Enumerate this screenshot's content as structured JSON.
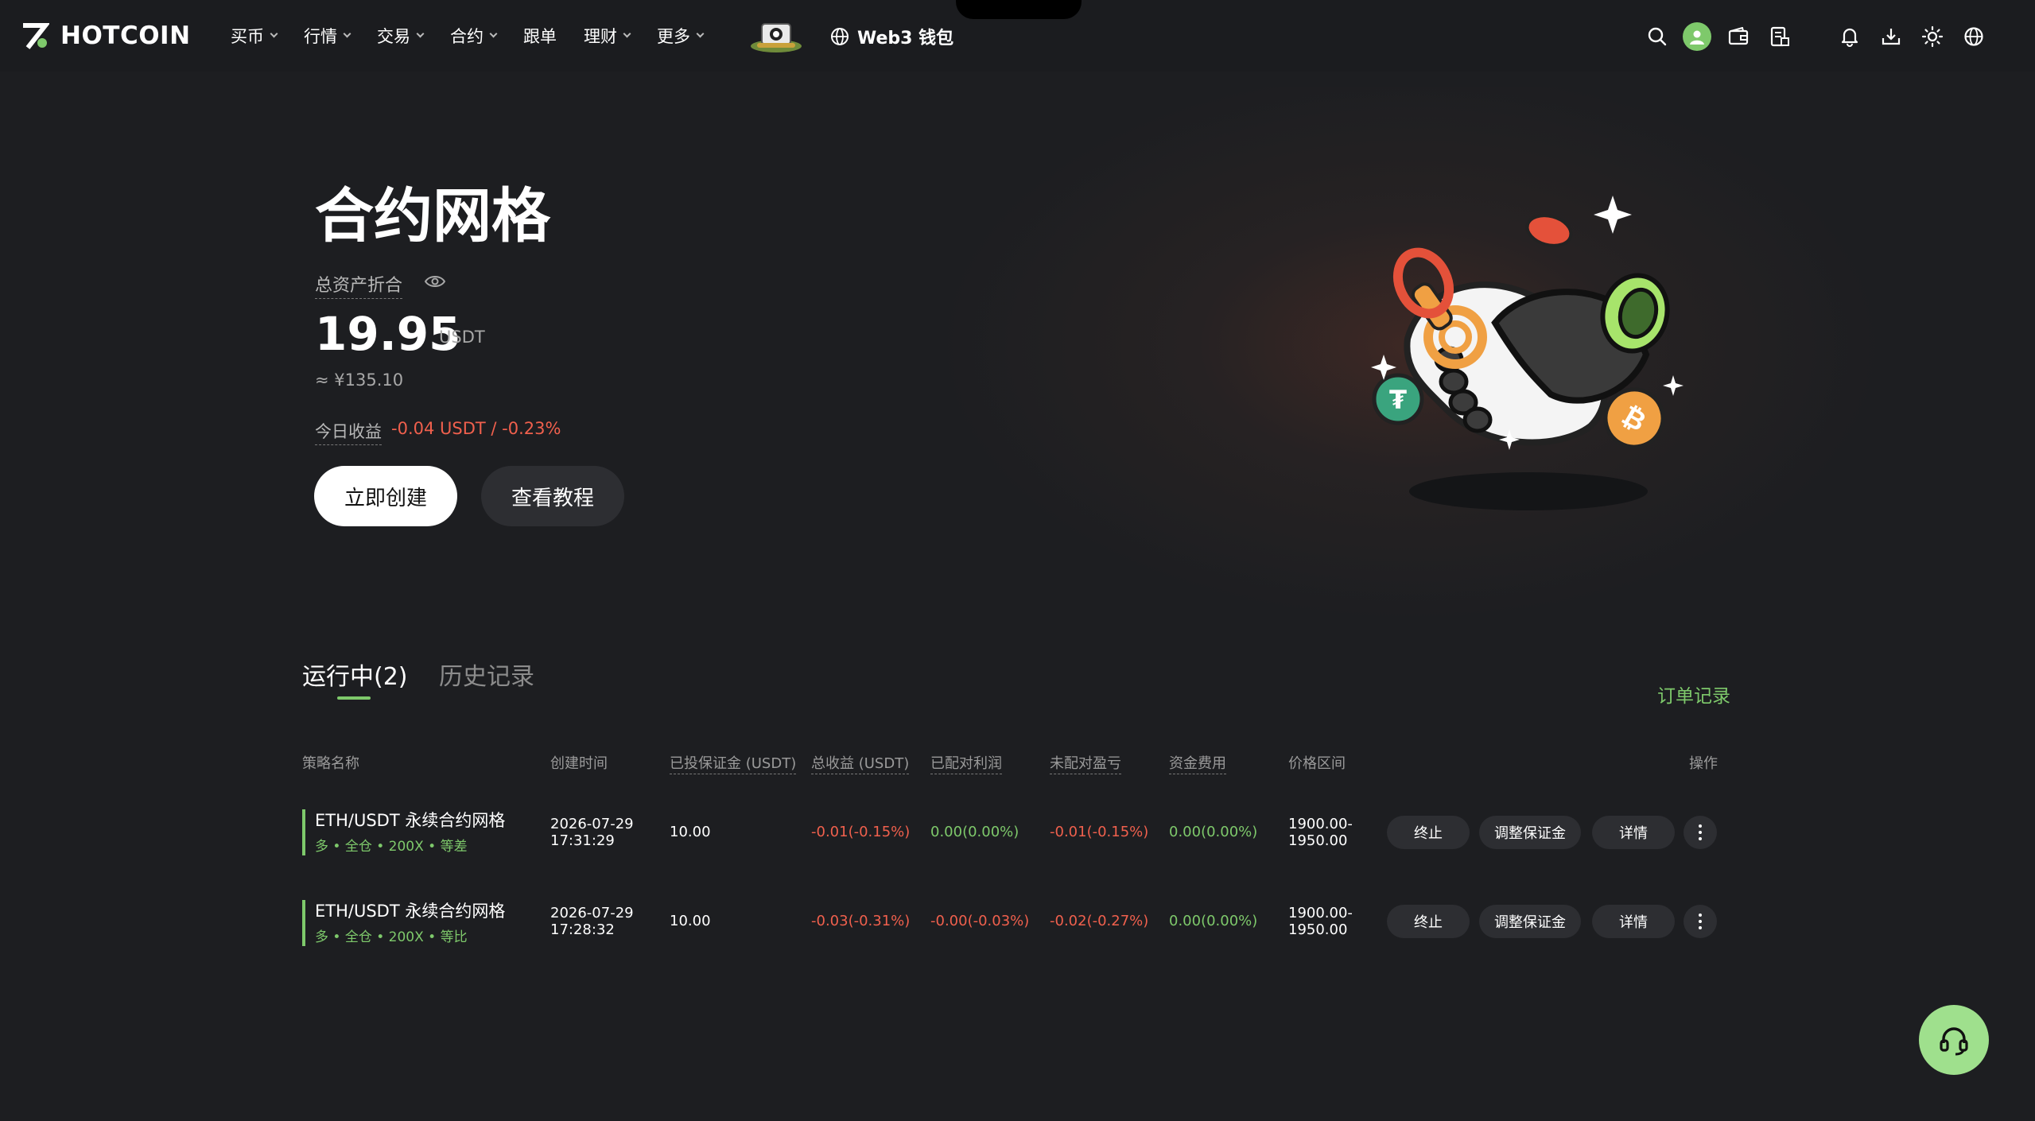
{
  "brand": {
    "name": "HOTCOIN",
    "accent": "#7ec96b",
    "loss_color": "#f0604d"
  },
  "nav": {
    "items": [
      {
        "label": "买币",
        "dropdown": true
      },
      {
        "label": "行情",
        "dropdown": true
      },
      {
        "label": "交易",
        "dropdown": true
      },
      {
        "label": "合约",
        "dropdown": true
      },
      {
        "label": "跟单",
        "dropdown": false
      },
      {
        "label": "理财",
        "dropdown": true
      },
      {
        "label": "更多",
        "dropdown": true
      }
    ],
    "web3_label": "Web3 钱包",
    "right_icons": [
      "search-icon",
      "avatar",
      "wallet-icon",
      "orders-icon",
      "bell-icon",
      "download-icon",
      "theme-sun-icon",
      "language-globe-icon"
    ]
  },
  "hero": {
    "title": "合约网格",
    "assets_label": "总资产折合",
    "assets_value": "19.95",
    "assets_unit": "USDT",
    "assets_cny": "≈ ¥135.10",
    "today_label": "今日收益",
    "today_value": "-0.04 USDT / -0.23%",
    "create_button": "立即创建",
    "tutorial_button": "查看教程"
  },
  "tabs": {
    "running": "运行中(2)",
    "history": "历史记录",
    "order_records": "订单记录"
  },
  "table": {
    "headers": {
      "name": "策略名称",
      "created": "创建时间",
      "margin": "已投保证金 (USDT)",
      "total_pnl": "总收益 (USDT)",
      "matched": "已配对利润",
      "unmatched": "未配对盈亏",
      "funding": "资金费用",
      "range": "价格区间",
      "actions": "操作"
    },
    "rows": [
      {
        "name": "ETH/USDT 永续合约网格",
        "tags": "多 • 全仓 • 200X • 等差",
        "date": "2026-07-29",
        "time": "17:31:29",
        "margin": "10.00",
        "total_pnl": "-0.01(-0.15%)",
        "matched": "0.00(0.00%)",
        "unmatched": "-0.01(-0.15%)",
        "funding": "0.00(0.00%)",
        "range_low": "1900.00-",
        "range_high": "1950.00",
        "stop": "终止",
        "adjust": "调整保证金",
        "detail": "详情"
      },
      {
        "name": "ETH/USDT 永续合约网格",
        "tags": "多 • 全仓 • 200X • 等比",
        "date": "2026-07-29",
        "time": "17:28:32",
        "margin": "10.00",
        "total_pnl": "-0.03(-0.31%)",
        "matched": "-0.00(-0.03%)",
        "unmatched": "-0.02(-0.27%)",
        "funding": "0.00(0.00%)",
        "range_low": "1900.00-",
        "range_high": "1950.00",
        "stop": "终止",
        "adjust": "调整保证金",
        "detail": "详情"
      }
    ]
  }
}
